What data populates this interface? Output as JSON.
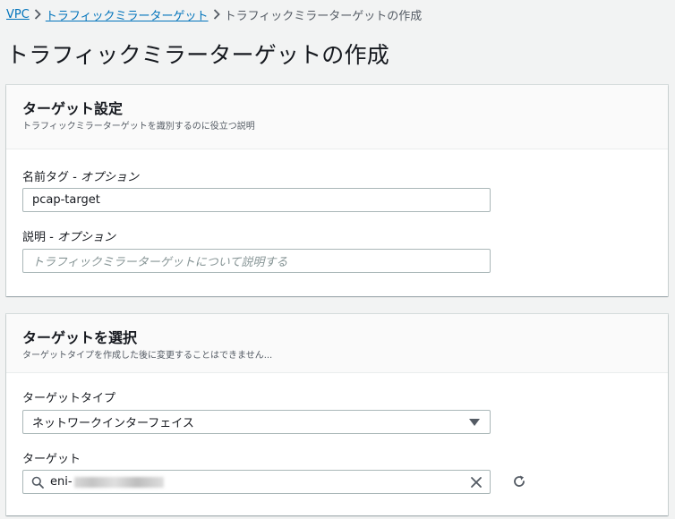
{
  "breadcrumb": {
    "items": [
      "VPC",
      "トラフィックミラーターゲット"
    ],
    "current": "トラフィックミラーターゲットの作成"
  },
  "page_title": "トラフィックミラーターゲットの作成",
  "target_settings": {
    "title": "ターゲット設定",
    "description": "トラフィックミラーターゲットを識別するのに役立つ説明",
    "name_tag": {
      "label": "名前タグ",
      "optional": " - オプション",
      "value": "pcap-target"
    },
    "description_field": {
      "label": "説明",
      "optional": " - オプション",
      "placeholder": "トラフィックミラーターゲットについて説明する"
    }
  },
  "choose_target": {
    "title": "ターゲットを選択",
    "description": "ターゲットタイプを作成した後に変更することはできません...",
    "target_type": {
      "label": "ターゲットタイプ",
      "value": "ネットワークインターフェイス"
    },
    "target": {
      "label": "ターゲット",
      "value_prefix": "eni-"
    }
  },
  "colors": {
    "link": "#0073bb",
    "text": "#16191f",
    "muted": "#545b64",
    "border": "#aab7b8",
    "background": "#f2f3f3"
  },
  "icons": [
    "chevron-right-icon",
    "search-icon",
    "clear-icon",
    "refresh-icon",
    "caret-down-icon"
  ]
}
